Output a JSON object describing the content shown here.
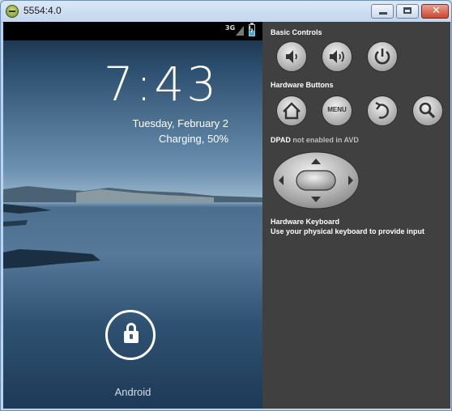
{
  "window": {
    "title": "5554:4.0",
    "controls": {
      "minimize": "minimize",
      "maximize": "maximize",
      "close": "✕"
    }
  },
  "phone": {
    "statusbar": {
      "network": "3G",
      "battery_level": 0.5
    },
    "lockscreen": {
      "time": "7:43",
      "date": "Tuesday, February 2",
      "charging": "Charging, 50%",
      "owner": "Android"
    }
  },
  "controls_panel": {
    "basic_controls": {
      "label": "Basic Controls",
      "buttons": [
        "volume-down-icon",
        "volume-up-icon",
        "power-icon"
      ]
    },
    "hardware_buttons": {
      "label": "Hardware Buttons",
      "menu_label": "MENU",
      "buttons": [
        "home-icon",
        "menu",
        "back-icon",
        "search-icon"
      ]
    },
    "dpad": {
      "label": "DPAD",
      "note": "not enabled in AVD"
    },
    "keyboard": {
      "title": "Hardware Keyboard",
      "hint": "Use your physical keyboard to provide input"
    }
  }
}
